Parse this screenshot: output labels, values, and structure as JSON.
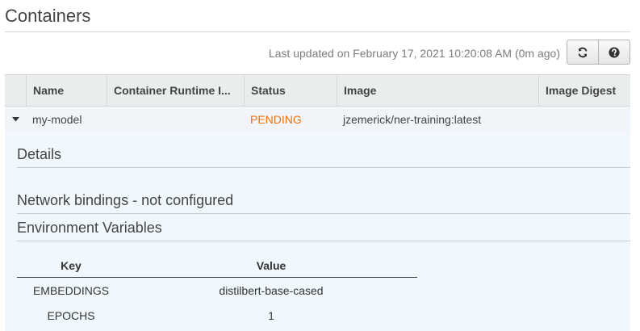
{
  "page": {
    "title": "Containers"
  },
  "toolbar": {
    "last_updated": "Last updated on February 17, 2021 10:20:08 AM (0m ago)",
    "refresh_icon": "refresh-icon",
    "help_icon": "help-icon"
  },
  "table": {
    "columns": [
      "Name",
      "Container Runtime I...",
      "Status",
      "Image",
      "Image Digest"
    ],
    "rows": [
      {
        "name": "my-model",
        "runtime_id": "",
        "status": "PENDING",
        "image": "jzemerick/ner-training:latest",
        "digest": ""
      }
    ]
  },
  "details": {
    "details_title": "Details",
    "network_title": "Network bindings - not configured",
    "env_title": "Environment Variables",
    "env_headers": {
      "key": "Key",
      "value": "Value"
    },
    "env_vars": [
      {
        "key": "EMBEDDINGS",
        "value": "distilbert-base-cased"
      },
      {
        "key": "EPOCHS",
        "value": "1"
      }
    ]
  },
  "colors": {
    "pending": "#ec7211",
    "row_bg": "#f1f4f8",
    "panel_bg": "#f1f8fd",
    "header_bg": "#eaeded"
  }
}
